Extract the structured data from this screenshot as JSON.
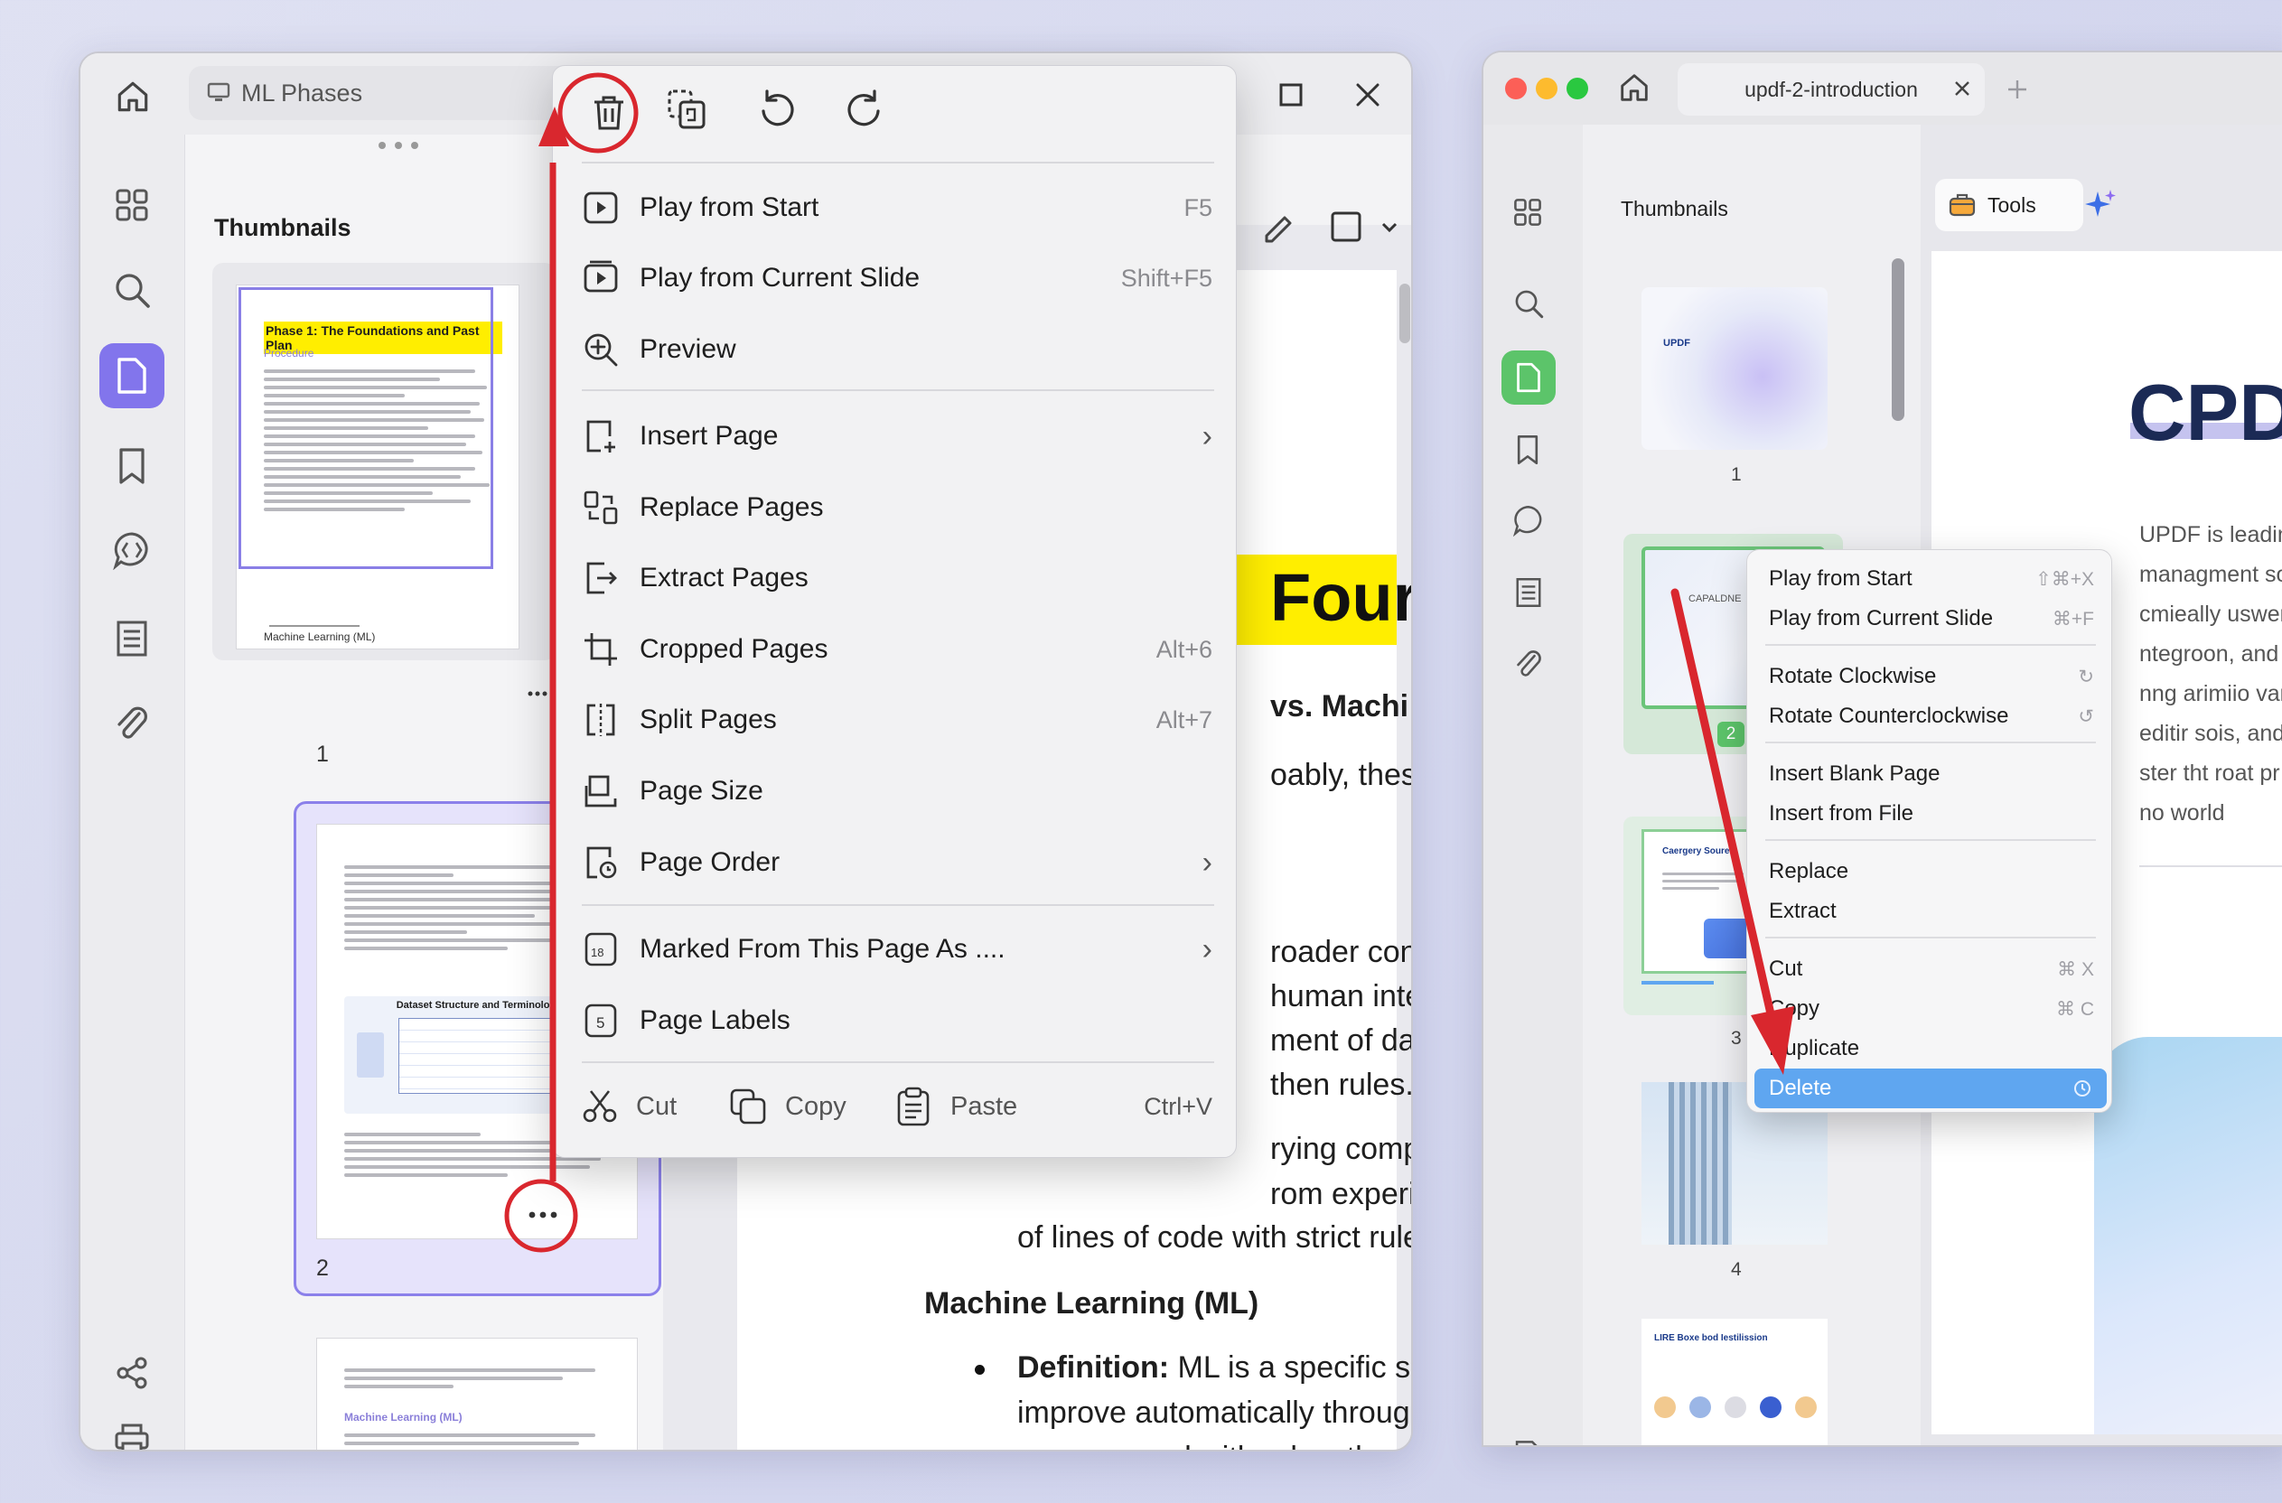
{
  "left_window": {
    "tab_title": "ML Phases",
    "thumbnails_title": "Thumbnails",
    "page_numbers": [
      "1",
      "2"
    ],
    "thumb1": {
      "heading": "Phase 1: The Foundations and Past Plan",
      "sub": "Procedure",
      "footer": "Machine Learning (ML)"
    },
    "thumb2": {
      "diagram_title": "Dataset Structure and Terminology"
    },
    "thumb3": {
      "heading": "Machine Learning (ML)"
    },
    "doc": {
      "title_fragment": "Four",
      "heading_fragment": "vs. Machi",
      "line1": "oably, thes",
      "para": [
        "roader con",
        "human inte",
        "ment of dat",
        "then rules.",
        "rying comp",
        "rom experi",
        "of lines of code with strict rules c"
      ],
      "ml_heading": "Machine Learning (ML)",
      "def_label": "Definition:",
      "def_lines": [
        " ML is a specific subs",
        "improve automatically through a",
        "programmed with rules, the mac"
      ]
    },
    "context_menu": {
      "items": [
        {
          "label": "Play from Start",
          "shortcut": "F5"
        },
        {
          "label": "Play from Current Slide",
          "shortcut": "Shift+F5"
        },
        {
          "label": "Preview",
          "shortcut": ""
        },
        {
          "label": "Insert Page",
          "shortcut": ""
        },
        {
          "label": "Replace Pages",
          "shortcut": ""
        },
        {
          "label": "Extract Pages",
          "shortcut": ""
        },
        {
          "label": "Cropped Pages",
          "shortcut": "Alt+6"
        },
        {
          "label": "Split Pages",
          "shortcut": "Alt+7"
        },
        {
          "label": "Page Size",
          "shortcut": ""
        },
        {
          "label": "Page Order",
          "shortcut": ""
        },
        {
          "label": "Marked From This Page As ....",
          "shortcut": ""
        },
        {
          "label": "Page Labels",
          "shortcut": ""
        }
      ],
      "cut": "Cut",
      "copy": "Copy",
      "paste": "Paste",
      "paste_shortcut": "Ctrl+V",
      "icon_18": "18",
      "icon_5": "5"
    }
  },
  "right_window": {
    "tab_title": "updf-2-introduction",
    "thumbnails_title": "Thumbnails",
    "tools_label": "Tools",
    "page_numbers": [
      "1",
      "2",
      "3",
      "4"
    ],
    "thumb1_logo": "UPDF",
    "thumb2_text": "CAPALDNE",
    "thumb3_title": "Caergery Soure",
    "thumb5_title": "LIRE Boxe bod Iestilission",
    "doc": {
      "title_fragment": "CPDF",
      "lines": [
        "UPDF is  leading,",
        "managment solu",
        "cmieally uswera",
        "ntegroon, and ex",
        "nng arimiio varn",
        "editir sois, and c",
        "ster tht roat pr",
        "no world"
      ]
    },
    "context_menu": {
      "items": [
        {
          "label": "Play from Start",
          "shortcut": "⇧⌘+X"
        },
        {
          "label": "Play from Current Slide",
          "shortcut": "⌘+F"
        },
        {
          "label": "Rotate Clockwise",
          "shortcut": "↻"
        },
        {
          "label": "Rotate Counterclockwise",
          "shortcut": "↺"
        },
        {
          "label": "Insert Blank Page",
          "shortcut": ""
        },
        {
          "label": "Insert from File",
          "shortcut": ""
        },
        {
          "label": "Replace",
          "shortcut": ""
        },
        {
          "label": "Extract",
          "shortcut": ""
        },
        {
          "label": "Cut",
          "shortcut": "⌘ X"
        },
        {
          "label": "Copy",
          "shortcut": "⌘ C"
        },
        {
          "label": "Duplicate",
          "shortcut": ""
        },
        {
          "label": "Delete",
          "shortcut": ""
        }
      ]
    }
  },
  "colors": {
    "accent": "#8275ec",
    "green_accent": "#5cc46a",
    "highlight_blue": "#5fa6f0",
    "annotation_red": "#d9272e",
    "doc_highlight": "#ffee00"
  }
}
